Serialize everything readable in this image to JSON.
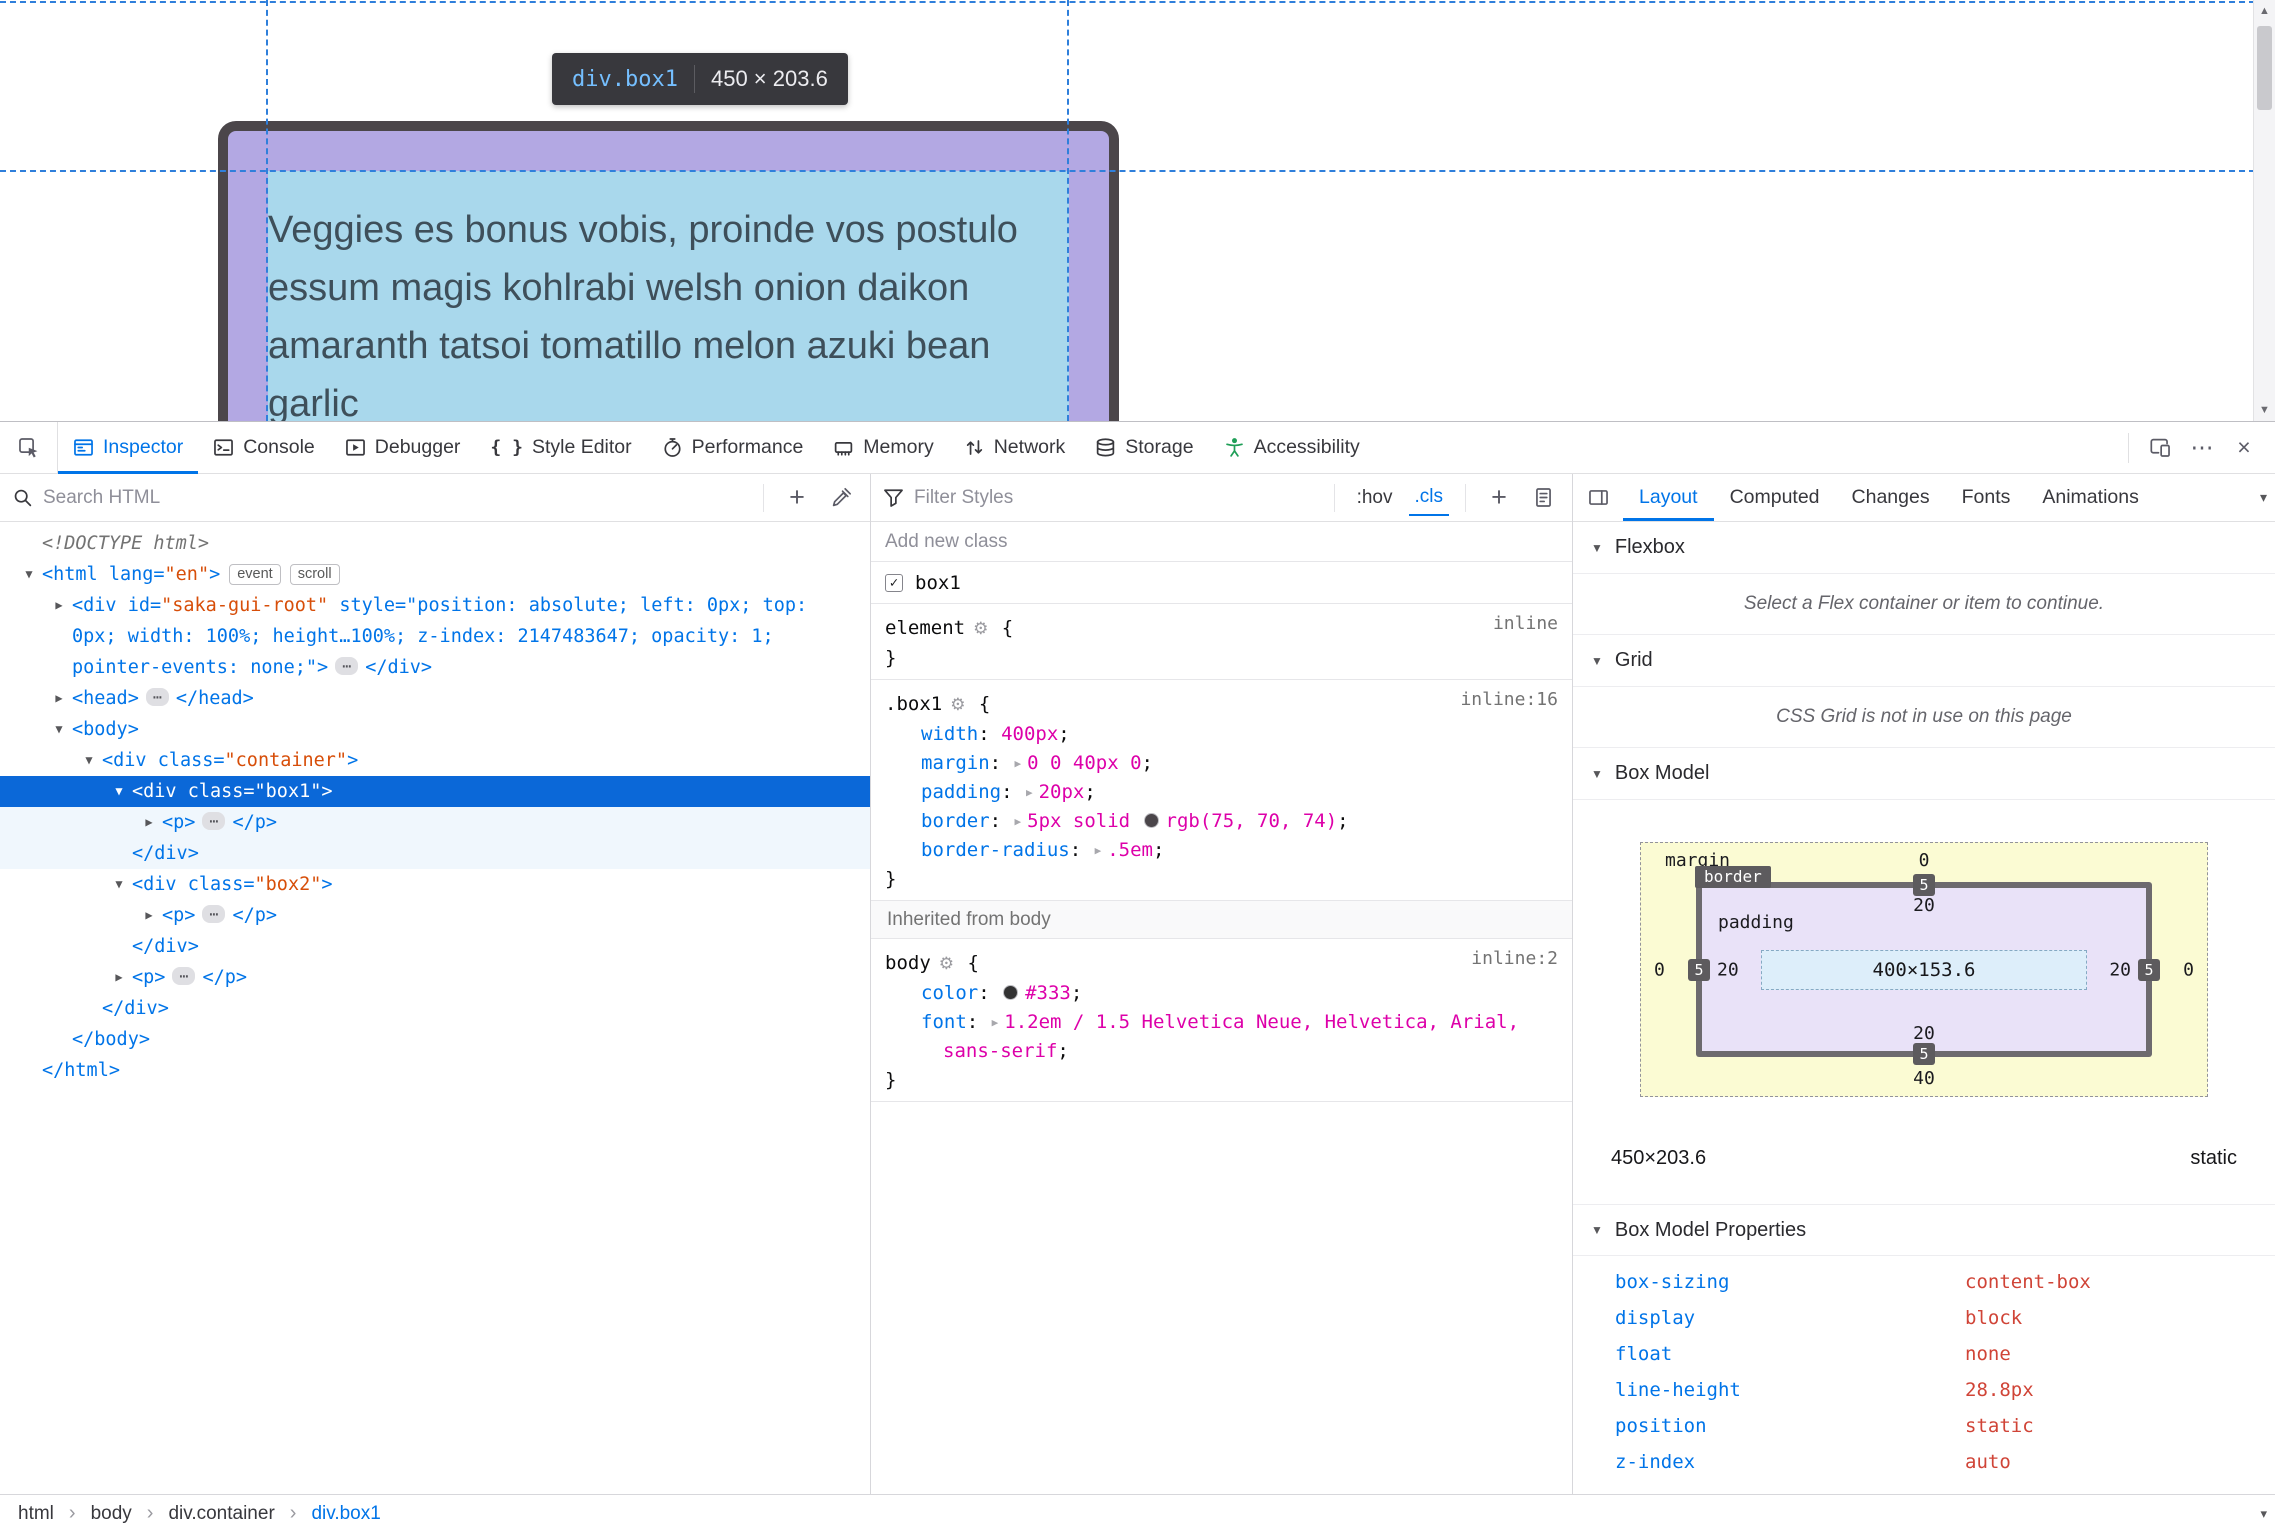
{
  "colors": {
    "accent_blue": "#0074e8",
    "selection_blue": "#0b68d8",
    "attr_value_orange": "#d74e09",
    "css_value_magenta": "#dd00a9",
    "guide_blue": "#2f7fdb",
    "border_swatch": "#4b464a",
    "body_color_swatch": "#333333",
    "accessibility_green": "#1f9e57",
    "highlight_padding_purple": "#b3a8e3",
    "highlight_content_blue": "#a9d8ec"
  },
  "page": {
    "tooltip": {
      "selector": "div.box1",
      "dims": "450 × 203.6"
    },
    "text_lines": [
      "Veggies es bonus vobis, proinde vos postulo",
      "essum magis kohlrabi welsh onion daikon",
      "amaranth tatsoi tomatillo melon azuki bean",
      "garlic"
    ]
  },
  "devtools_toolbar": {
    "tabs": [
      {
        "id": "inspector",
        "icon": "inspector-icon",
        "label": "Inspector",
        "active": true
      },
      {
        "id": "console",
        "icon": "console-icon",
        "label": "Console"
      },
      {
        "id": "debugger",
        "icon": "debugger-icon",
        "label": "Debugger"
      },
      {
        "id": "style-editor",
        "icon": "style-editor-icon",
        "label": "Style Editor"
      },
      {
        "id": "performance",
        "icon": "performance-icon",
        "label": "Performance"
      },
      {
        "id": "memory",
        "icon": "memory-icon",
        "label": "Memory"
      },
      {
        "id": "network",
        "icon": "network-icon",
        "label": "Network"
      },
      {
        "id": "storage",
        "icon": "storage-icon",
        "label": "Storage"
      },
      {
        "id": "accessibility",
        "icon": "accessibility-icon",
        "label": "Accessibility"
      }
    ]
  },
  "markup_pane": {
    "search_placeholder": "Search HTML",
    "lines": [
      {
        "ind": 0,
        "tok": [
          [
            "doc",
            "<!DOCTYPE html>"
          ]
        ]
      },
      {
        "ind": 0,
        "tw": "o",
        "tok": [
          [
            "tag",
            "<html"
          ],
          [
            "tag",
            " lang="
          ],
          [
            "val",
            "\"en\""
          ],
          [
            "tag",
            ">"
          ],
          [
            "badge",
            "event"
          ],
          [
            "badge",
            "scroll"
          ]
        ]
      },
      {
        "ind": 1,
        "tw": "c",
        "tok": [
          [
            "tag",
            "<div"
          ],
          [
            "tag",
            " id="
          ],
          [
            "val",
            "\"saka-gui-root\""
          ],
          [
            "tag",
            " style="
          ],
          [
            "sty",
            "\"position: absolute; left: 0px; top:"
          ]
        ]
      },
      {
        "ind": 1,
        "cont": 1,
        "tok": [
          [
            "sty",
            "0px; width: 100%; height…100%; z-index: 2147483647; opacity: 1;"
          ]
        ]
      },
      {
        "ind": 1,
        "cont": 1,
        "tok": [
          [
            "sty",
            "pointer-events: none;\""
          ],
          [
            "tag",
            ">"
          ],
          [
            "ell",
            "⋯"
          ],
          [
            "tag",
            "</div>"
          ]
        ]
      },
      {
        "ind": 1,
        "tw": "c",
        "tok": [
          [
            "tag",
            "<head>"
          ],
          [
            "ell",
            "⋯"
          ],
          [
            "tag",
            "</head>"
          ]
        ]
      },
      {
        "ind": 1,
        "tw": "o",
        "tok": [
          [
            "tag",
            "<body>"
          ]
        ]
      },
      {
        "ind": 2,
        "tw": "o",
        "tok": [
          [
            "tag",
            "<div"
          ],
          [
            "tag",
            " class="
          ],
          [
            "val",
            "\"container\""
          ],
          [
            "tag",
            ">"
          ]
        ]
      },
      {
        "ind": 3,
        "tw": "o",
        "sel": 1,
        "tok": [
          [
            "tag",
            "<div"
          ],
          [
            "tag",
            " class="
          ],
          [
            "val",
            "\"box1\""
          ],
          [
            "tag",
            ">"
          ]
        ]
      },
      {
        "ind": 4,
        "tw": "c",
        "csel": 1,
        "tok": [
          [
            "tag",
            "<p>"
          ],
          [
            "ell",
            "⋯"
          ],
          [
            "tag",
            "</p>"
          ]
        ]
      },
      {
        "ind": 3,
        "csel": 1,
        "tok": [
          [
            "tag",
            "</div>"
          ]
        ]
      },
      {
        "ind": 3,
        "tw": "o",
        "tok": [
          [
            "tag",
            "<div"
          ],
          [
            "tag",
            " class="
          ],
          [
            "val",
            "\"box2\""
          ],
          [
            "tag",
            ">"
          ]
        ]
      },
      {
        "ind": 4,
        "tw": "c",
        "tok": [
          [
            "tag",
            "<p>"
          ],
          [
            "ell",
            "⋯"
          ],
          [
            "tag",
            "</p>"
          ]
        ]
      },
      {
        "ind": 3,
        "tok": [
          [
            "tag",
            "</div>"
          ]
        ]
      },
      {
        "ind": 3,
        "tw": "c",
        "tok": [
          [
            "tag",
            "<p>"
          ],
          [
            "ell",
            "⋯"
          ],
          [
            "tag",
            "</p>"
          ]
        ]
      },
      {
        "ind": 2,
        "tok": [
          [
            "tag",
            "</div>"
          ]
        ]
      },
      {
        "ind": 1,
        "tok": [
          [
            "tag",
            "</body>"
          ]
        ]
      },
      {
        "ind": 0,
        "tok": [
          [
            "tag",
            "</html>"
          ]
        ]
      }
    ]
  },
  "rules_pane": {
    "filter_placeholder": "Filter Styles",
    "hov_label": ":hov",
    "cls_label": ".cls",
    "add_class_placeholder": "Add new class",
    "class_toggles": [
      {
        "label": "box1",
        "checked": true
      }
    ],
    "rules": [
      {
        "selector": "element",
        "link": "inline",
        "props": []
      },
      {
        "selector": ".box1",
        "link": "inline:16",
        "props": [
          {
            "name": "width",
            "value": "400px"
          },
          {
            "name": "margin",
            "arrow": true,
            "value": "0 0 40px 0"
          },
          {
            "name": "padding",
            "arrow": true,
            "value": "20px"
          },
          {
            "name": "border",
            "arrow": true,
            "pre": "5px solid ",
            "swatch": "#4b464a",
            "value": "rgb(75, 70, 74)"
          },
          {
            "name": "border-radius",
            "arrow": true,
            "value": ".5em"
          }
        ]
      }
    ],
    "inherited_label": "Inherited from body",
    "inherited_rules": [
      {
        "selector": "body",
        "link": "inline:2",
        "props": [
          {
            "name": "color",
            "swatch": "#333333",
            "value": "#333"
          },
          {
            "name": "font",
            "arrow": true,
            "value": "1.2em / 1.5 Helvetica Neue, Helvetica, Arial,",
            "value2": "sans-serif"
          }
        ]
      }
    ]
  },
  "layout_pane": {
    "tabs": [
      {
        "label": "Layout",
        "active": true
      },
      {
        "label": "Computed"
      },
      {
        "label": "Changes"
      },
      {
        "label": "Fonts"
      },
      {
        "label": "Animations"
      }
    ],
    "flexbox": {
      "title": "Flexbox",
      "message": "Select a Flex container or item to continue."
    },
    "grid": {
      "title": "Grid",
      "message": "CSS Grid is not in use on this page"
    },
    "box_model_title": "Box Model",
    "box_model": {
      "margin_label": "margin",
      "border_label": "border",
      "padding_label": "padding",
      "margin": {
        "top": "0",
        "right": "0",
        "bottom": "40",
        "left": "0"
      },
      "border": {
        "top": "5",
        "right": "5",
        "bottom": "5",
        "left": "5"
      },
      "padding": {
        "top": "20",
        "right": "20",
        "bottom": "20",
        "left": "20"
      },
      "content": "400×153.6",
      "element_size": "450×203.6",
      "element_position": "static"
    },
    "properties_title": "Box Model Properties",
    "properties": [
      {
        "name": "box-sizing",
        "value": "content-box"
      },
      {
        "name": "display",
        "value": "block"
      },
      {
        "name": "float",
        "value": "none"
      },
      {
        "name": "line-height",
        "value": "28.8px"
      },
      {
        "name": "position",
        "value": "static"
      },
      {
        "name": "z-index",
        "value": "auto"
      }
    ]
  },
  "breadcrumbs": [
    {
      "label": "html"
    },
    {
      "label": "body"
    },
    {
      "label": "div.container"
    },
    {
      "label": "div.box1",
      "current": true
    }
  ]
}
